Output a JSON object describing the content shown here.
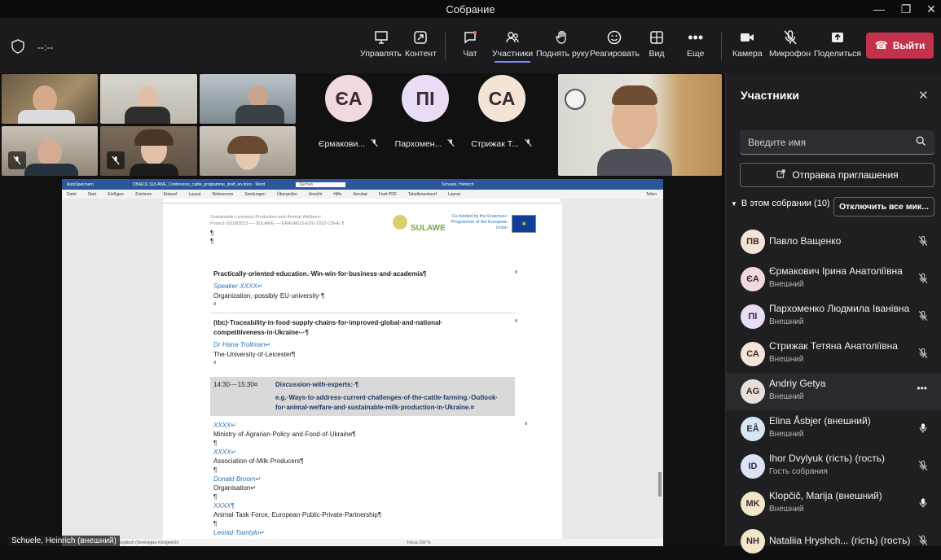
{
  "window": {
    "title": "Собрание"
  },
  "topbar": {
    "timer": "--:--"
  },
  "toolbar": {
    "items": [
      {
        "label": "Управлять",
        "icon": "presenter-icon"
      },
      {
        "label": "Контент",
        "icon": "share-content-icon"
      },
      {
        "label": "Чат",
        "icon": "chat-icon"
      },
      {
        "label": "Участники",
        "icon": "people-icon"
      },
      {
        "label": "Поднять руку",
        "icon": "raise-hand-icon"
      },
      {
        "label": "Реагировать",
        "icon": "smile-icon"
      },
      {
        "label": "Вид",
        "icon": "grid-view-icon"
      },
      {
        "label": "Еще",
        "icon": "more-icon"
      },
      {
        "label": "Камера",
        "icon": "camera-icon"
      },
      {
        "label": "Микрофон",
        "icon": "mic-muted-icon"
      },
      {
        "label": "Поделиться",
        "icon": "share-icon"
      }
    ],
    "leave_label": "Выйти",
    "colors": {
      "leave": "#c4314b",
      "active_underline": "#7f85f5"
    }
  },
  "stage": {
    "avatar_tiles": [
      {
        "initials": "ЄА",
        "name": "Єрмакови...",
        "color": "#f1d9dd"
      },
      {
        "initials": "ПІ",
        "name": "Пархомен...",
        "color": "#e9ddf5"
      },
      {
        "initials": "СА",
        "name": "Стрижак Т...",
        "color": "#f4e4d6"
      }
    ],
    "presenter_label": "Schuele, Heinrich (внешний)"
  },
  "document": {
    "app_bar": [
      "AutoSpeichern",
      "CBAR11 SULAWE_Conference_cattle_programme_draft_en.docx - Word",
      "Suchen",
      "Schuele, Heinrich",
      "Teilen"
    ],
    "menus": [
      "Datei",
      "Start",
      "Einfügen",
      "Zeichnen",
      "Entwurf",
      "Layout",
      "Referenzen",
      "Sendungen",
      "Überprüfen",
      "Ansicht",
      "Hilfe",
      "Acrobat",
      "Foxit PDF",
      "Tabellenentwurf",
      "Layout"
    ],
    "header_left_1": "Sustainable·Livestock·Production·and·Animal·Welfare↵",
    "header_left_2": "Project·101083023·—·SULAWE·—·ERASMUS-EDU-2022-CBHE·¶",
    "logo_text": "SULAWE",
    "eu_text": "Co-funded by the Erasmus+ Programme of the European Union",
    "blocks": [
      {
        "title": "Practically·oriented·education.·Win-win·for·business·and·academia¶",
        "speaker": "Speaker·XXXX↵",
        "org": "Organization,·possibly·EU·university·¶"
      },
      {
        "title": "(tbc)·Traceability·in·food·supply·chains·for·improved·global·and·national·",
        "title2": "competitiveness·in·Ukraine·-·¶",
        "speaker": "Dr·Hana·Trollman↵",
        "org": "The·University·of·Leicester¶"
      }
    ],
    "discussion": {
      "time": "14:30·–·15:30¤",
      "title": "Discussion·with·experts:·¶",
      "line1": "e.g.·Ways·to·address·current·challenges·of·the·cattle·farming.·Outlook·",
      "line2": "for·animal·welfare·and·sustainable·milk·production·in·Ukraine.¤"
    },
    "list": [
      {
        "who": "XXXX↵",
        "org": "Ministry·of·Agrarian·Policy·and·Food·of·Ukraine¶"
      },
      {
        "who": "XXXX↵",
        "org": "Association·of·Milk·Producers¶"
      },
      {
        "who": "Donald·Broom↵",
        "org": "Organisation↵"
      },
      {
        "who": "XXXX¶",
        "org": "Animal·Task·Force,·European·Public-Private·Partnership¶"
      },
      {
        "who": "Leonid·Tsentylo↵",
        "org": ""
      }
    ],
    "pilcrow": "¶",
    "cellmark": "¤",
    "status_left": "Englisch (Vereinigtes Königreich)",
    "status_right": "Fokus  100 %"
  },
  "panel": {
    "title": "Участники",
    "search_placeholder": "Введите имя",
    "invite_label": "Отправка приглашения",
    "section_label": "В этом собрании (10)",
    "mute_all_label": "Отключить все мик...",
    "participants": [
      {
        "initials": "ПВ",
        "name": "Павло Ващенко",
        "sub": "",
        "color": "#f4e4d6",
        "mic": "muted"
      },
      {
        "initials": "ЄА",
        "name": "Єрмакович Ірина Анатоліївна",
        "sub": "Внешний",
        "color": "#f1d9dd",
        "mic": "muted"
      },
      {
        "initials": "ПІ",
        "name": "Пархоменко Людмила Іванівна",
        "sub": "Внешний",
        "color": "#e9ddf5",
        "mic": "muted"
      },
      {
        "initials": "СА",
        "name": "Стрижак Тетяна Анатоліївна",
        "sub": "Внешний",
        "color": "#f4e4d6",
        "mic": "muted"
      },
      {
        "initials": "AG",
        "name": "Andriy Getya",
        "sub": "Внешний",
        "color": "#e8dfd8",
        "mic": "more"
      },
      {
        "initials": "EÅ",
        "name": "Elina Åsbjer (внешний)",
        "sub": "Внешний",
        "color": "#d6e6f2",
        "mic": "on"
      },
      {
        "initials": "ID",
        "name": "Ihor Dvylyuk (гість) (гость)",
        "sub": "Гость собрания",
        "color": "#dde3f6",
        "mic": "muted"
      },
      {
        "initials": "MK",
        "name": "Klopčič, Marija (внешний)",
        "sub": "Внешний",
        "color": "#f3e5c8",
        "mic": "on"
      },
      {
        "initials": "NH",
        "name": "Nataliia Hryshch...  (гість) (гость)",
        "sub": "",
        "color": "#f3e5c8",
        "mic": "muted"
      }
    ]
  }
}
